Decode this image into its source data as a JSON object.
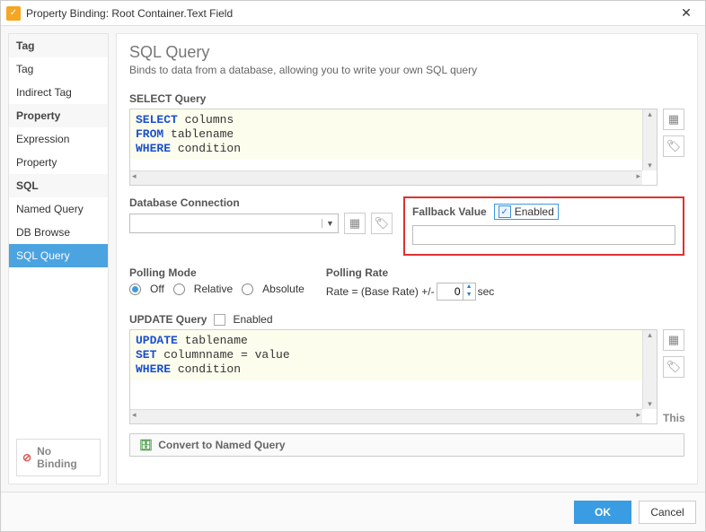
{
  "window": {
    "title": "Property Binding: Root Container.Text Field"
  },
  "sidebar": {
    "cat_tag": "Tag",
    "items_tag": [
      "Tag",
      "Indirect Tag"
    ],
    "cat_prop": "Property",
    "items_prop": [
      "Expression",
      "Property"
    ],
    "cat_sql": "SQL",
    "items_sql": [
      "Named Query",
      "DB Browse",
      "SQL Query"
    ],
    "active": "SQL Query",
    "no_binding": "No Binding"
  },
  "main": {
    "heading": "SQL Query",
    "desc": "Binds to data from a database, allowing you to write your own SQL query",
    "select_label": "SELECT Query",
    "select_kw1": "SELECT",
    "select_t1": " columns",
    "select_kw2": "FROM",
    "select_t2": " tablename",
    "select_kw3": "WHERE",
    "select_t3": " condition",
    "db_label": "Database Connection",
    "fallback_label": "Fallback Value",
    "enabled": "Enabled",
    "polling_mode_label": "Polling Mode",
    "poll_off": "Off",
    "poll_rel": "Relative",
    "poll_abs": "Absolute",
    "polling_rate_label": "Polling Rate",
    "rate_prefix": "Rate = (Base Rate) +/-",
    "rate_value": "0",
    "rate_unit": "sec",
    "update_label": "UPDATE Query",
    "update_enabled_label": "Enabled",
    "update_kw1": "UPDATE",
    "update_t1": " tablename",
    "update_kw2": "SET",
    "update_t2": " columnname = value",
    "update_kw3": "WHERE",
    "update_t3": " condition",
    "this_label": "This",
    "convert_label": "Convert to Named Query"
  },
  "footer": {
    "ok": "OK",
    "cancel": "Cancel"
  }
}
